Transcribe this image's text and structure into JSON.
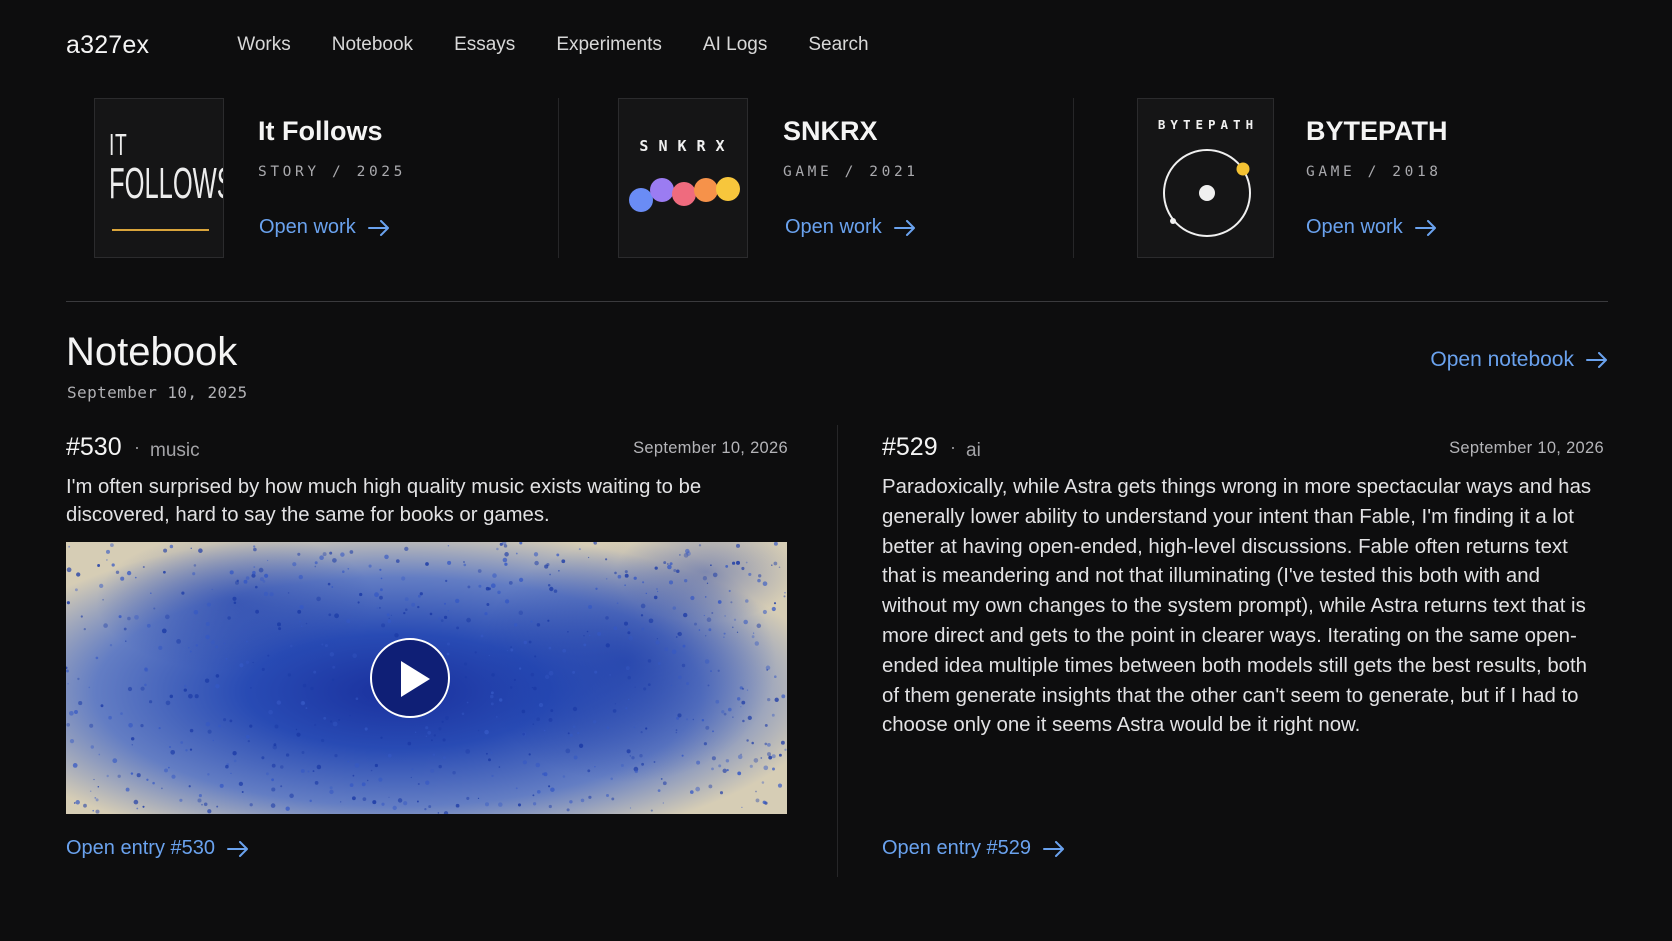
{
  "nav": {
    "logo": "a327ex",
    "links": [
      "Works",
      "Notebook",
      "Essays",
      "Experiments",
      "AI Logs",
      "Search"
    ]
  },
  "works": [
    {
      "title": "It Follows",
      "meta": "STORY / 2025",
      "open_label": "Open work",
      "thumb": {
        "line1": "IT",
        "line2": "FOLLOWS",
        "accent": "#d9a43b"
      }
    },
    {
      "title": "SNKRX",
      "meta": "GAME / 2021",
      "open_label": "Open work",
      "thumb": {
        "word": "SNKRX",
        "dot_colors": [
          "#6a8cf5",
          "#9b7cf2",
          "#ef6b7e",
          "#f6924a",
          "#f7c63c"
        ]
      }
    },
    {
      "title": "BYTEPATH",
      "meta": "GAME / 2018",
      "open_label": "Open work",
      "thumb": {
        "word": "BYTEPATH",
        "accent": "#f4c233"
      }
    }
  ],
  "notebook": {
    "title": "Notebook",
    "date": "September 10, 2025",
    "open_label": "Open notebook"
  },
  "entries": [
    {
      "number": "#530",
      "separator": "·",
      "tag": "music",
      "date": "September 10, 2026",
      "text": "I'm often surprised by how much high quality music exists waiting to be discovered, hard to say the same for books or games.",
      "media": {
        "type": "video",
        "play_icon": "play-icon"
      },
      "open_label": "Open entry #530"
    },
    {
      "number": "#529",
      "separator": "·",
      "tag": "ai",
      "date": "September 10, 2026",
      "text": "Paradoxically, while Astra gets things wrong in more spectacular ways and has generally lower ability to understand your intent than Fable, I'm finding it a lot better at having open-ended, high-level discussions. Fable often returns text that is meandering and not that illuminating (I've tested this both with and without my own changes to the system prompt), while Astra returns text that is more direct and gets to the point in clearer ways. Iterating on the same open-ended idea multiple times between both models still gets the best results, both of them generate insights that the other can't seem to generate, but if I had to choose only one it seems Astra would be it right now.",
      "open_label": "Open entry #529"
    }
  ],
  "colors": {
    "background": "#0d0d0e",
    "link": "#6aa2ee",
    "video_blue": "#1d3fb0",
    "video_cream": "#d8cfb8"
  }
}
